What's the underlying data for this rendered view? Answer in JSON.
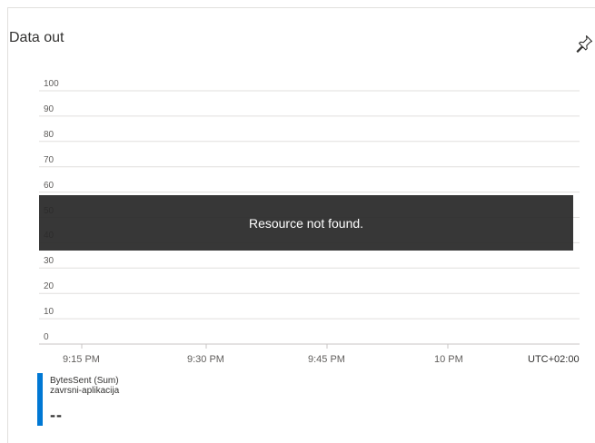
{
  "tile": {
    "title": "Data out",
    "pin_icon": "pin-icon"
  },
  "chart_data": {
    "type": "line",
    "title": "Data out",
    "y_ticks": [
      "100",
      "90",
      "80",
      "70",
      "60",
      "50",
      "40",
      "30",
      "20",
      "10",
      "0"
    ],
    "x_ticks": [
      "9:15 PM",
      "9:30 PM",
      "9:45 PM",
      "10 PM"
    ],
    "ylim": [
      0,
      100
    ],
    "timezone": "UTC+02:00",
    "series": [],
    "grid": true,
    "legend_position": "bottom-left"
  },
  "overlay": {
    "message": "Resource not found."
  },
  "legend": {
    "metric": "BytesSent (Sum)",
    "resource": "zavrsni-aplikacija",
    "value": "--",
    "color": "#0078d4"
  }
}
